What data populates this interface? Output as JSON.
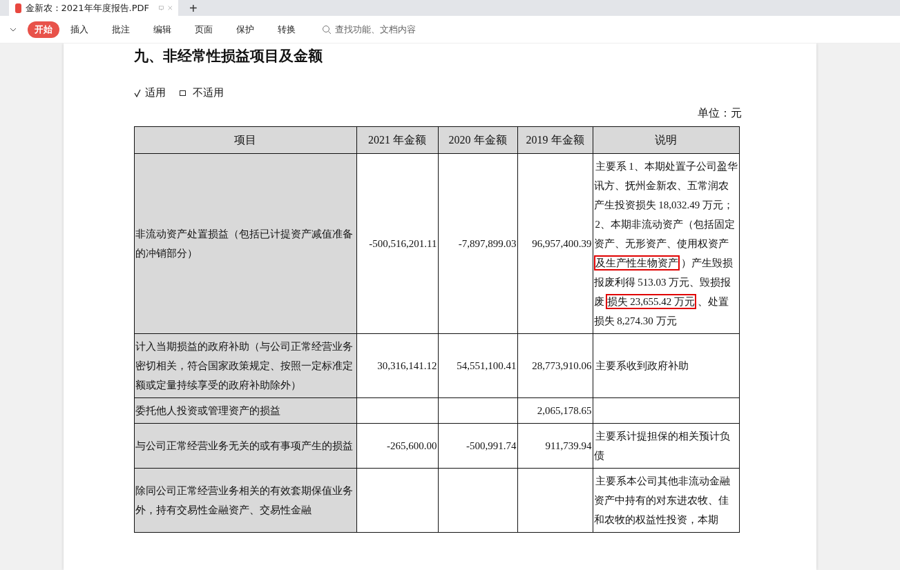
{
  "tabs": [
    {
      "title": "金新农：2021年年度报告.PDF",
      "selected": true
    }
  ],
  "new_tab": "+",
  "toolbar": {
    "items": [
      {
        "label": "开始",
        "selected": true
      },
      {
        "label": "插入",
        "selected": false
      },
      {
        "label": "批注",
        "selected": false
      },
      {
        "label": "编辑",
        "selected": false
      },
      {
        "label": "页面",
        "selected": false
      },
      {
        "label": "保护",
        "selected": false
      },
      {
        "label": "转换",
        "selected": false
      }
    ],
    "search": {
      "placeholder": "查找功能、文档内容"
    }
  },
  "document": {
    "heading": "九、非经常性损益项目及金额",
    "applicability": [
      {
        "label": "适用",
        "checked": true
      },
      {
        "label": "不适用",
        "checked": false
      }
    ],
    "unit": "单位：元",
    "table": {
      "columns": [
        "项目",
        "2021 年金额",
        "2020 年金额",
        "2019 年金额",
        "说明"
      ],
      "rows": [
        {
          "item": "非流动资产处置损益（包括已计提资产减值准备的冲销部分）",
          "y2021": "-500,516,201.11",
          "y2020": "-7,897,899.03",
          "y2019": "96,957,400.39",
          "note": [
            [
              {
                "text": "主要系 1、本期处置子公司盈华讯方、抚州金新农、五常润农产生投资损失 18,032.49 万元；",
                "boxed": false
              }
            ],
            [
              {
                "text": "2、本期非流动资产（包括固定资产、无形资产、使用权资产",
                "boxed": false
              },
              {
                "text": "及生产性生物资产",
                "boxed": true
              },
              {
                "text": "）产生毁损报废利得 513.03 万元、毁损报废",
                "boxed": false
              },
              {
                "text": "损失 23,655.42 万元",
                "boxed": true
              },
              {
                "text": "、处置损失 8,274.30 万元",
                "boxed": false
              }
            ]
          ]
        },
        {
          "item": "计入当期损益的政府补助（与公司正常经营业务密切相关，符合国家政策规定、按照一定标准定额或定量持续享受的政府补助除外）",
          "y2021": "30,316,141.12",
          "y2020": "54,551,100.41",
          "y2019": "28,773,910.06",
          "note": [
            [
              {
                "text": "主要系收到政府补助",
                "boxed": false
              }
            ]
          ]
        },
        {
          "item": "委托他人投资或管理资产的损益",
          "y2019": "2,065,178.65"
        },
        {
          "item": "与公司正常经营业务无关的或有事项产生的损益",
          "y2021": "-265,600.00",
          "y2020": "-500,991.74",
          "y2019": "911,739.94",
          "note": [
            [
              {
                "text": "主要系计提担保的相关预计负债",
                "boxed": false
              }
            ]
          ]
        },
        {
          "item": "除同公司正常经营业务相关的有效套期保值业务外，持有交易性金融资产、交易性金融",
          "note": [
            [
              {
                "text": "主要系本公司其他非流动金融资产中持有的对东进农牧、佳和农牧的权益性投资，本期",
                "boxed": false
              }
            ]
          ]
        }
      ]
    }
  }
}
